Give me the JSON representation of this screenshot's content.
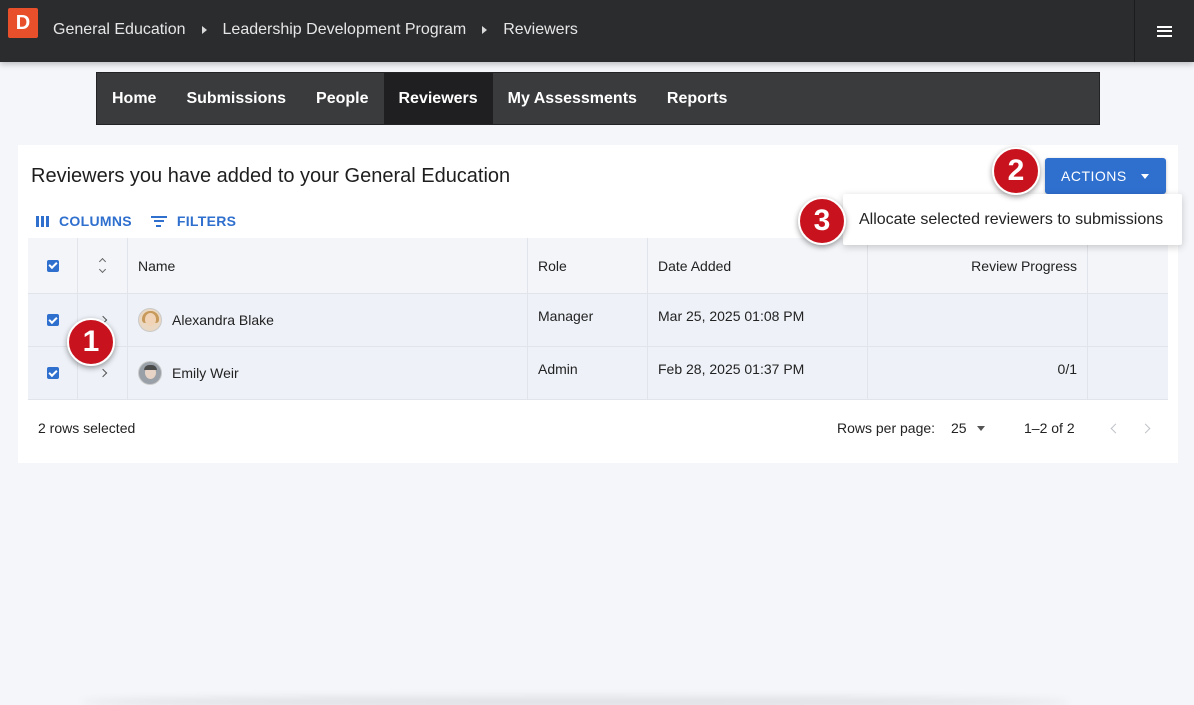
{
  "topbar": {
    "logo_letter": "D",
    "breadcrumbs": [
      "General Education",
      "Leadership Development Program",
      "Reviewers"
    ]
  },
  "nav": {
    "items": [
      {
        "label": "Home",
        "active": false
      },
      {
        "label": "Submissions",
        "active": false
      },
      {
        "label": "People",
        "active": false
      },
      {
        "label": "Reviewers",
        "active": true
      },
      {
        "label": "My Assessments",
        "active": false
      },
      {
        "label": "Reports",
        "active": false
      }
    ]
  },
  "card": {
    "title": "Reviewers you have added to your General Education",
    "actions_label": "ACTIONS",
    "columns_label": "COLUMNS",
    "filters_label": "FILTERS"
  },
  "dropdown": {
    "item": "Allocate selected reviewers to submissions"
  },
  "table": {
    "headers": {
      "name": "Name",
      "role": "Role",
      "date": "Date Added",
      "progress": "Review Progress"
    },
    "rows": [
      {
        "name": "Alexandra Blake",
        "role": "Manager",
        "date": "Mar 25, 2025 01:08 PM",
        "progress": "",
        "selected": true
      },
      {
        "name": "Emily Weir",
        "role": "Admin",
        "date": "Feb 28, 2025 01:37 PM",
        "progress": "0/1",
        "selected": true
      }
    ]
  },
  "footer": {
    "selected_text": "2 rows selected",
    "rows_per_page_label": "Rows per page:",
    "rows_per_page_value": "25",
    "range": "1–2 of 2"
  },
  "markers": [
    "1",
    "2",
    "3"
  ],
  "colors": {
    "accent": "#2f6fce",
    "marker": "#c8131e",
    "logo": "#e8502b",
    "topbar": "#2b2c2e"
  }
}
